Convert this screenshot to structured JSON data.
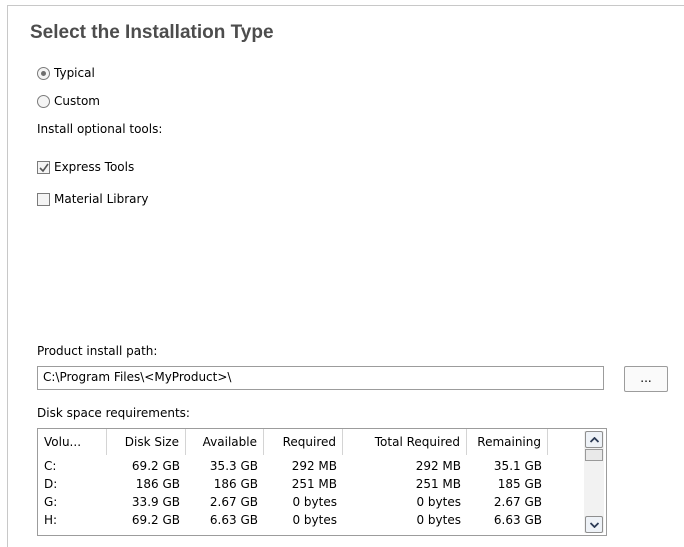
{
  "title": "Select the Installation Type",
  "install_type": {
    "options": [
      {
        "label": "Typical",
        "selected": true
      },
      {
        "label": "Custom",
        "selected": false
      }
    ]
  },
  "optional_tools": {
    "heading": "Install optional tools:",
    "items": [
      {
        "label": "Express Tools",
        "checked": true
      },
      {
        "label": "Material Library",
        "checked": false
      }
    ]
  },
  "install_path": {
    "label": "Product install path:",
    "value": "C:\\Program Files\\<MyProduct>\\",
    "browse_label": "..."
  },
  "disk_space": {
    "label": "Disk space requirements:",
    "columns": [
      "Volu...",
      "Disk Size",
      "Available",
      "Required",
      "Total Required",
      "Remaining"
    ],
    "rows": [
      [
        "C:",
        "69.2 GB",
        "35.3 GB",
        "292 MB",
        "292 MB",
        "35.1 GB"
      ],
      [
        "D:",
        "186 GB",
        "186 GB",
        "251 MB",
        "251 MB",
        "185 GB"
      ],
      [
        "G:",
        "33.9 GB",
        "2.67 GB",
        "0 bytes",
        "0 bytes",
        "2.67 GB"
      ],
      [
        "H:",
        "69.2 GB",
        "6.63 GB",
        "0 bytes",
        "0 bytes",
        "6.63 GB"
      ]
    ]
  },
  "icons": {
    "radio_selected": "radio-selected-icon",
    "checkbox_checked": "checkmark-icon",
    "scroll_up": "chevron-up-icon",
    "scroll_down": "chevron-down-icon"
  }
}
